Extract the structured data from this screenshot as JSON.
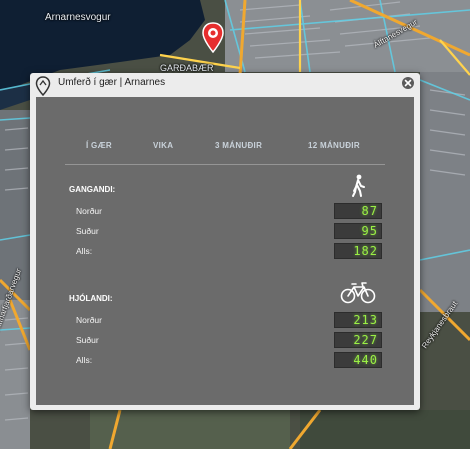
{
  "map": {
    "water_label": "Arnarnesvogur",
    "district_label": "GARÐABÆR",
    "streets": [
      "Hafnarfjarðarvegur",
      "Reykjanesbraut",
      "Álftanesvegur"
    ],
    "colors": {
      "water": "#0f1f33",
      "land": "#3c4a3a",
      "road_major": "#f0a830",
      "road_minor": "#5fd0e8",
      "buildings": "#c9ccd2"
    }
  },
  "popup": {
    "title": "Umferð í gær | Arnarnes",
    "tabs": [
      "Í GÆR",
      "VIKA",
      "3 MÁNUÐIR",
      "12 MÁNUÐIR"
    ],
    "sections": [
      {
        "title": "GANGANDI:",
        "icon": "pedestrian-icon",
        "rows": [
          {
            "label": "Norður",
            "value": "87"
          },
          {
            "label": "Suður",
            "value": "95"
          },
          {
            "label": "Alls:",
            "value": "182"
          }
        ]
      },
      {
        "title": "HJÓLANDI:",
        "icon": "bicycle-icon",
        "rows": [
          {
            "label": "Norður",
            "value": "213"
          },
          {
            "label": "Suður",
            "value": "227"
          },
          {
            "label": "Alls:",
            "value": "440"
          }
        ]
      }
    ],
    "colors": {
      "panel": "#6b6b6b",
      "lcd_text": "#9bf045",
      "lcd_bg": "#3b3b3b"
    }
  }
}
